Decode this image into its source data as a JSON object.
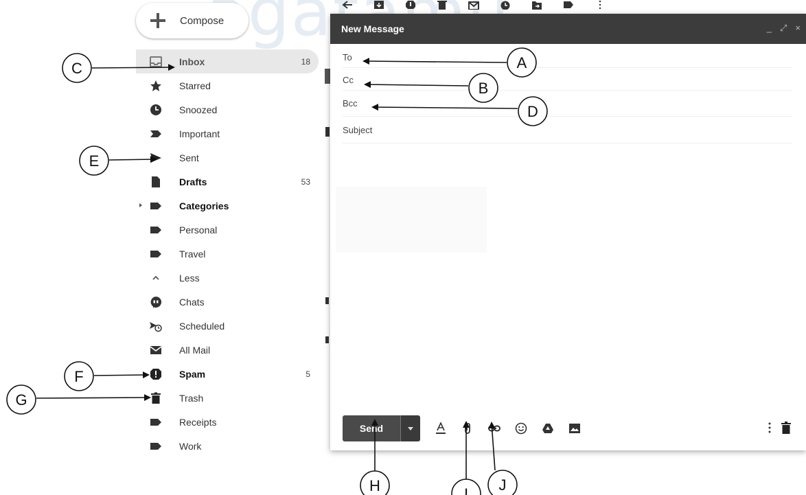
{
  "watermark": "agatamu",
  "compose": {
    "label": "Compose"
  },
  "sidebar": {
    "items": [
      {
        "label": "Inbox",
        "count": "18",
        "icon": "inbox-icon"
      },
      {
        "label": "Starred",
        "count": "",
        "icon": "star-icon"
      },
      {
        "label": "Snoozed",
        "count": "",
        "icon": "clock-icon"
      },
      {
        "label": "Important",
        "count": "",
        "icon": "important-icon"
      },
      {
        "label": "Sent",
        "count": "",
        "icon": "send-icon"
      },
      {
        "label": "Drafts",
        "count": "53",
        "icon": "draft-icon"
      },
      {
        "label": "Categories",
        "count": "",
        "icon": "label-icon"
      },
      {
        "label": "Personal",
        "count": "",
        "icon": "label-icon"
      },
      {
        "label": "Travel",
        "count": "",
        "icon": "label-icon"
      },
      {
        "label": "Less",
        "count": "",
        "icon": "chevron-up-icon"
      },
      {
        "label": "Chats",
        "count": "",
        "icon": "chat-icon"
      },
      {
        "label": "Scheduled",
        "count": "",
        "icon": "scheduled-icon"
      },
      {
        "label": "All Mail",
        "count": "",
        "icon": "mail-icon"
      },
      {
        "label": "Spam",
        "count": "5",
        "icon": "spam-icon"
      },
      {
        "label": "Trash",
        "count": "",
        "icon": "trash-icon"
      },
      {
        "label": "Receipts",
        "count": "",
        "icon": "label-icon"
      },
      {
        "label": "Work",
        "count": "",
        "icon": "label-icon"
      }
    ]
  },
  "dialog": {
    "title": "New Message",
    "controls": {
      "minimize": "_",
      "expand": "⤢",
      "close": "×"
    },
    "fields": {
      "to": "To",
      "cc": "Cc",
      "bcc": "Bcc",
      "subject": "Subject"
    },
    "send_label": "Send"
  },
  "annotations": {
    "A": "A",
    "B": "B",
    "C": "C",
    "D": "D",
    "E": "E",
    "F": "F",
    "G": "G",
    "H": "H",
    "I": "I",
    "J": "J"
  },
  "colors": {
    "header": "#3c3c3c",
    "send": "#4a4a4a",
    "active_row": "#e8e8e8"
  }
}
